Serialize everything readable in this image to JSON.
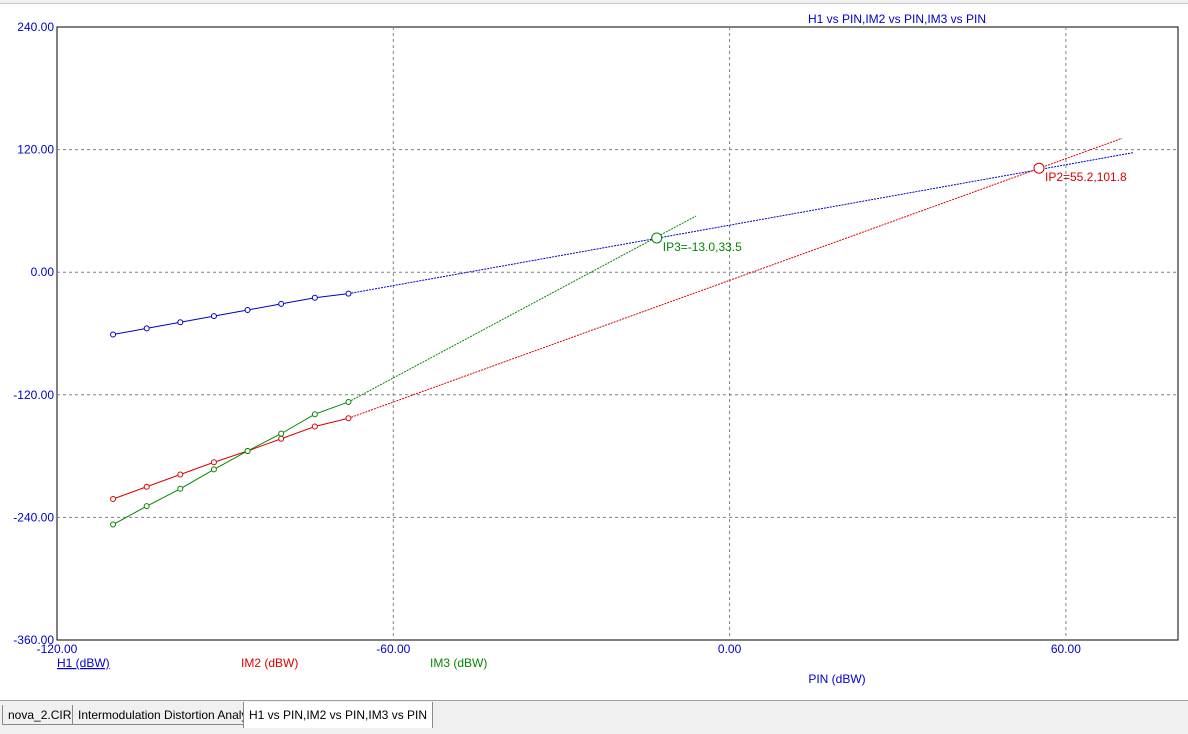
{
  "tabs": [
    {
      "label": "nova_2.CIR",
      "active": false
    },
    {
      "label": "Intermodulation Distortion Analysis",
      "active": false
    },
    {
      "label": "H1 vs PIN,IM2 vs PIN,IM3 vs PIN",
      "active": true
    }
  ],
  "chart_data": {
    "type": "line",
    "title": "H1 vs PIN,IM2 vs PIN,IM3 vs PIN",
    "xlabel": "PIN (dBW)",
    "xlim": [
      -120,
      80
    ],
    "ylim": [
      -360,
      240
    ],
    "x_ticks": [
      "-120.00",
      "-60.00",
      "0.00",
      "60.00"
    ],
    "y_ticks": [
      "240.00",
      "120.00",
      "0.00",
      "-120.00",
      "-240.00",
      "-360.00"
    ],
    "grid": true,
    "series": [
      {
        "name": "H1 (dBW)",
        "color": "#0000cc",
        "x": [
          -110,
          -104,
          -98,
          -92,
          -86,
          -80,
          -74,
          -68
        ],
        "y": [
          -61,
          -55,
          -49,
          -43,
          -37,
          -31,
          -25,
          -21
        ],
        "extrapolation": {
          "x": [
            -68,
            72
          ],
          "y": [
            -21,
            117
          ]
        }
      },
      {
        "name": "IM2 (dBW)",
        "color": "#dd0000",
        "x": [
          -110,
          -104,
          -98,
          -92,
          -86,
          -80,
          -74,
          -68
        ],
        "y": [
          -222,
          -210,
          -198,
          -186,
          -175,
          -163,
          -151,
          -143
        ],
        "extrapolation": {
          "x": [
            -68,
            70
          ],
          "y": [
            -143,
            131
          ]
        }
      },
      {
        "name": "IM3 (dBW)",
        "color": "#008800",
        "x": [
          -110,
          -104,
          -98,
          -92,
          -86,
          -80,
          -74,
          -68
        ],
        "y": [
          -247,
          -229,
          -212,
          -193,
          -175,
          -158,
          -139,
          -127
        ],
        "extrapolation": {
          "x": [
            -68,
            -6
          ],
          "y": [
            -127,
            55
          ]
        }
      }
    ],
    "annotations": [
      {
        "text": "IP3=-13.0,33.5",
        "x": -13.0,
        "y": 33.5,
        "color": "#008800"
      },
      {
        "text": "IP2=55.2,101.8",
        "x": 55.2,
        "y": 101.8,
        "color": "#dd0000"
      }
    ]
  }
}
